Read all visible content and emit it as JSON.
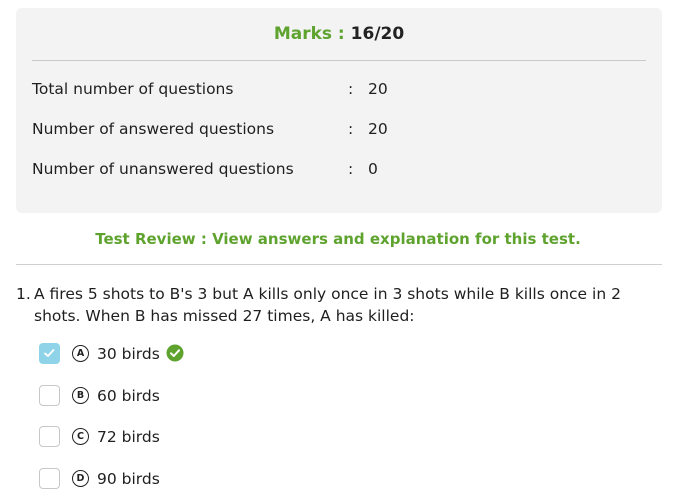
{
  "summary": {
    "marks_label": "Marks :",
    "marks_value": "16/20",
    "rows": [
      {
        "label": "Total number of questions",
        "colon": ":",
        "value": "20"
      },
      {
        "label": "Number of answered questions",
        "colon": ":",
        "value": "20"
      },
      {
        "label": "Number of unanswered questions",
        "colon": ":",
        "value": "0"
      }
    ]
  },
  "review_link": "Test Review : View answers and explanation for this test.",
  "question": {
    "number": "1.",
    "text": "A fires 5 shots to B's 3 but A kills only once in 3 shots while B kills once in 2 shots. When B has missed 27 times, A has killed:",
    "options": [
      {
        "letter": "A",
        "text": "30 birds",
        "checked": true,
        "correct": true
      },
      {
        "letter": "B",
        "text": "60 birds",
        "checked": false
      },
      {
        "letter": "C",
        "text": "72 birds",
        "checked": false
      },
      {
        "letter": "D",
        "text": "90 birds",
        "checked": false
      }
    ]
  },
  "colors": {
    "accent_green": "#5fa32f",
    "checked_box": "#8fd3e8",
    "card_bg": "#f3f3f3"
  },
  "icons": {
    "check": "check-icon",
    "correct": "check-circle-icon"
  }
}
